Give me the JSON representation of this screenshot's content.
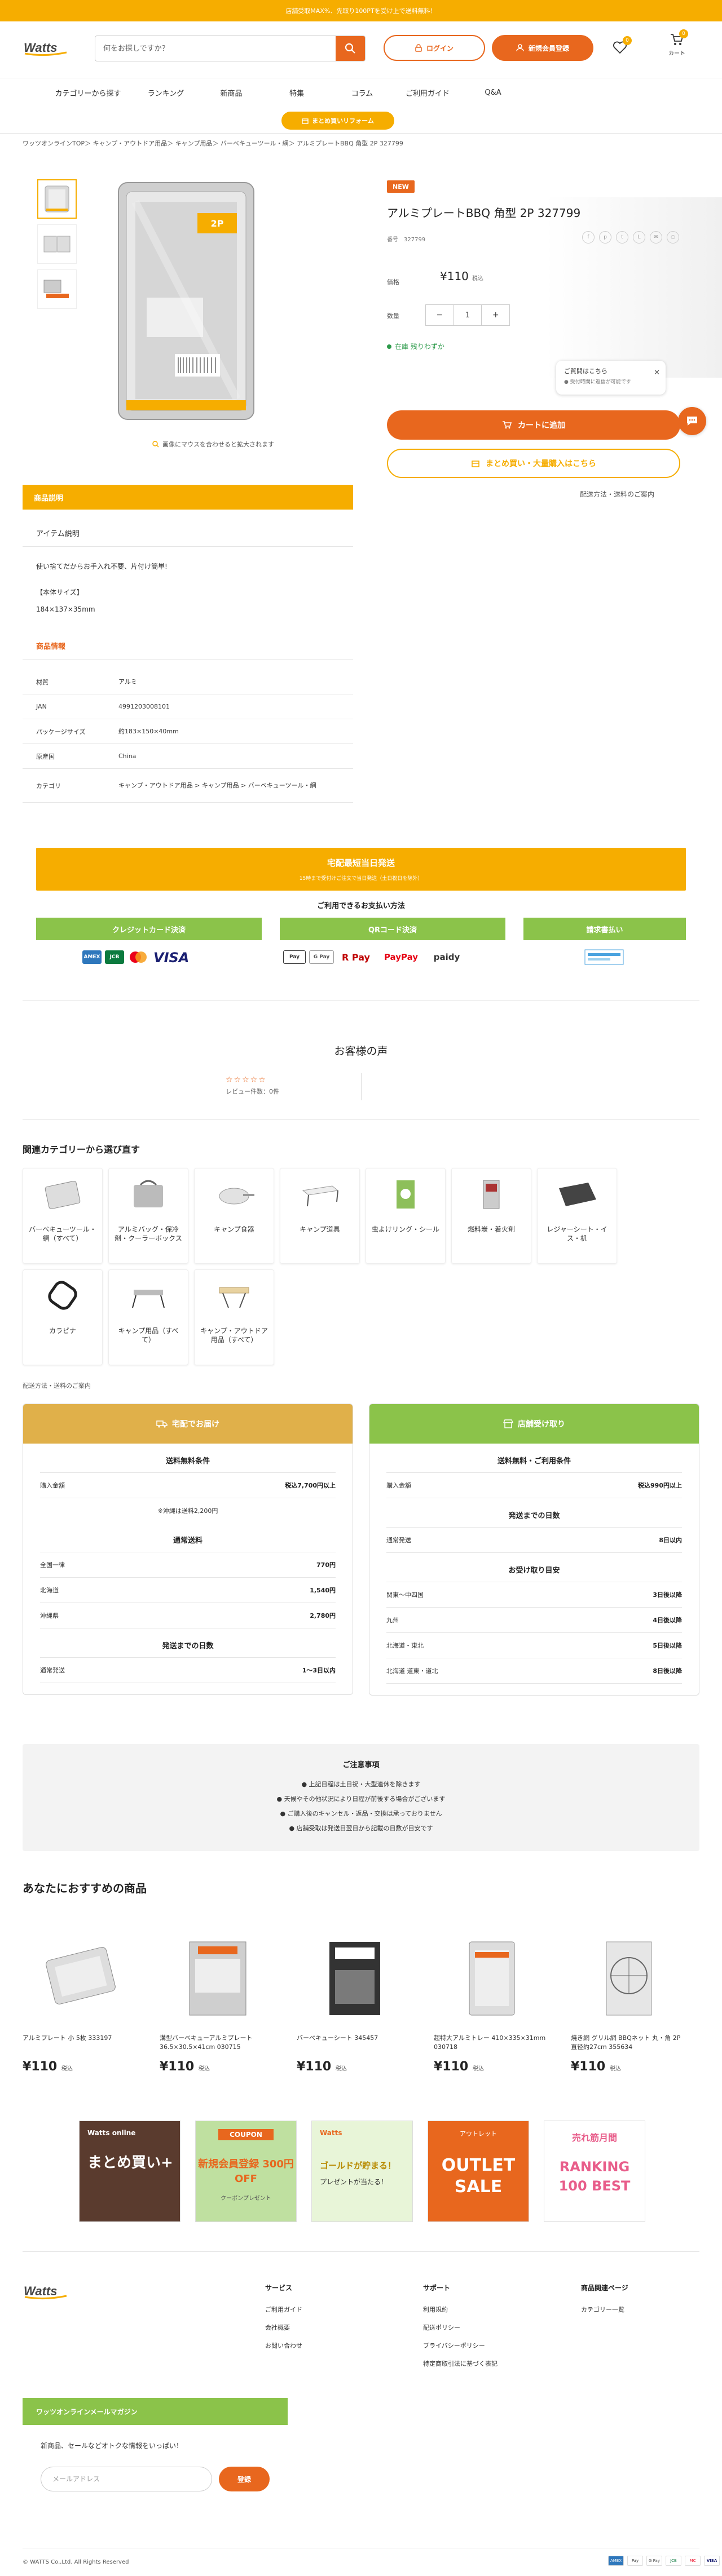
{
  "topbar": {
    "text": "店舗受取MAX%、先取り100PTを受け上で送料無料！"
  },
  "header": {
    "logo_text": "Watts",
    "search_placeholder": "何をお探しですか？",
    "login_label": "ログイン",
    "register_label": "新規会員登録",
    "fav_count": "0",
    "cart_count": "0",
    "cart_label": "カート"
  },
  "nav": {
    "items": [
      "カテゴリーから探す",
      "ランキング",
      "新商品",
      "特集",
      "コラム",
      "ご利用ガイド",
      "Q&A"
    ],
    "bulk_label": "まとめ買いリフォーム"
  },
  "breadcrumb": "ワッツオンラインTOP＞ キャンプ・アウトドア用品＞ キャンプ用品＞ バーベキューツール・網＞ アルミプレートBBQ 角型 2P 327799",
  "product": {
    "new_badge": "NEW",
    "title": "アルミプレートBBQ 角型 2P 327799",
    "number_label": "番号",
    "number_value": "327799",
    "price_label": "価格",
    "price": "¥110",
    "tax_label": "税込",
    "qty_label": "数量",
    "qty_minus": "−",
    "qty_value": "1",
    "qty_plus": "+",
    "stock": "在庫 残りわずか",
    "zoom_note": "画像にマウスを合わせると拡大されます",
    "add_cart": "カートに追加",
    "bulk_buy": "まとめ買い・大量購入はこちら",
    "ship_link": "配送方法・送料のご案内",
    "share_icons": [
      "f",
      "p",
      "t",
      "L",
      "✉",
      "○"
    ]
  },
  "chat": {
    "title": "ご質問はこちら",
    "sub": "● 受付時間に返信が可能です"
  },
  "description": {
    "head": "商品説明",
    "item_title": "アイテム説明",
    "text1": "使い捨てだからお手入れ不要、片付け簡単!",
    "size_label": "【本体サイズ】",
    "size_value": "184×137×35mm"
  },
  "specs": {
    "head": "商品情報",
    "rows": [
      {
        "k": "材質",
        "v": "アルミ"
      },
      {
        "k": "JAN",
        "v": "4991203008101"
      },
      {
        "k": "パッケージサイズ",
        "v": "約183×150×40mm"
      },
      {
        "k": "原産国",
        "v": "China"
      },
      {
        "k": "カテゴリ",
        "v": "キャンプ・アウトドア用品 > キャンプ用品 > バーベキューツール・網"
      }
    ]
  },
  "delivery_band": {
    "title": "宅配最短当日発送",
    "sub": "15時まで受付けご注文で当日発送（土日祝日を除外）"
  },
  "payment": {
    "head": "ご利用できるお支払い方法",
    "methods": [
      "クレジットカード決済",
      "QRコード決済",
      "請求書払い"
    ],
    "qr_logos": [
      "Pay",
      "G Pay",
      "R Pay",
      "PayPay",
      "paidy"
    ]
  },
  "reviews": {
    "title": "お客様の声",
    "stars": "☆☆☆☆☆",
    "count": "レビュー件数：0件"
  },
  "categories": {
    "title": "関連カテゴリーから選び直す",
    "items": [
      "バーベキューツール・網（すべて）",
      "アルミバッグ・保冷剤・クーラーボックス",
      "キャンプ食器",
      "キャンプ道具",
      "虫よけリング・シール",
      "燃料炭・着火剤",
      "レジャーシート・イス・机",
      "カラビナ",
      "キャンプ用品（すべて）",
      "キャンプ・アウトドア用品（すべて）"
    ]
  },
  "shipping": {
    "note": "配送方法・送料のご案内",
    "home": {
      "head": "宅配でお届け",
      "free_title": "送料無料条件",
      "free_k": "購入金額",
      "free_v": "税込7,700円以上",
      "free_note": "※沖縄は送料2,200円",
      "fee_title": "通常送料",
      "fees": [
        {
          "k": "全国一律",
          "v": "770円"
        },
        {
          "k": "北海道",
          "v": "1,540円"
        },
        {
          "k": "沖縄県",
          "v": "2,780円"
        }
      ],
      "days_title": "発送までの日数",
      "days_k": "通常発送",
      "days_v": "1〜3日以内"
    },
    "store": {
      "head": "店舗受け取り",
      "free_title": "送料無料・ご利用条件",
      "free_k": "購入金額",
      "free_v": "税込990円以上",
      "days_title": "発送までの日数",
      "days_k": "通常発送",
      "days_v": "8日以内",
      "recv_title": "お受け取り目安",
      "recv": [
        {
          "k": "関東〜中四国",
          "v": "3日後以降"
        },
        {
          "k": "九州",
          "v": "4日後以降"
        },
        {
          "k": "北海道・東北",
          "v": "5日後以降"
        },
        {
          "k": "北海道 道東・道北",
          "v": "8日後以降"
        }
      ]
    }
  },
  "notice": {
    "title": "ご注意事項",
    "lines": [
      "上記日程は土日祝・大型連休を除きます",
      "天候やその他状況により日程が前後する場合がございます",
      "ご購入後のキャンセル・返品・交換は承っておりません",
      "店舗受取は発送日翌日から記載の日数が目安です"
    ]
  },
  "recommend": {
    "title": "あなたにおすすめの商品",
    "items": [
      {
        "name": "アルミプレート 小 5枚 333197",
        "price": "¥110",
        "tax": "税込"
      },
      {
        "name": "溝型バーベキューアルミプレート 36.5×30.5×41cm 030715",
        "price": "¥110",
        "tax": "税込"
      },
      {
        "name": "バーベキューシート 345457",
        "price": "¥110",
        "tax": "税込"
      },
      {
        "name": "超特大アルミトレー 410×335×31mm 030718",
        "price": "¥110",
        "tax": "税込"
      },
      {
        "name": "焼き網 グリル網 BBQネット 丸・角 2P 直径約27cm 355634",
        "price": "¥110",
        "tax": "税込"
      }
    ]
  },
  "banners": [
    {
      "top": "Watts online",
      "main": "まとめ買い+"
    },
    {
      "top": "COUPON",
      "main": "新規会員登録 300円OFF",
      "sub": "クーポンプレゼント"
    },
    {
      "top": "Watts",
      "main": "ゴールドが貯まる！",
      "sub": "プレゼントが当たる！"
    },
    {
      "top": "アウトレット",
      "main": "OUTLET SALE"
    },
    {
      "top": "売れ筋月間",
      "main": "RANKING 100 BEST"
    }
  ],
  "footer": {
    "logo_text": "Watts",
    "services_head": "サービス",
    "services": [
      "ご利用ガイド",
      "会社概要",
      "お問い合わせ"
    ],
    "support_head": "サポート",
    "support": [
      "利用規約",
      "配送ポリシー",
      "プライバシーポリシー",
      "特定商取引法に基づく表記"
    ],
    "related_head": "商品関連ページ",
    "related": [
      "カテゴリー一覧"
    ],
    "mm_head": "ワッツオンラインメールマガジン",
    "mm_text": "新商品、セールなどオトクな情報をいっぱい！",
    "mm_placeholder": "メールアドレス",
    "mm_button": "登録",
    "copyright": "© WATTS Co.,Ltd. All Rights Reserved",
    "pay_icons": [
      "AMEX",
      "Pay",
      "G Pay",
      "JCB",
      "MC",
      "VISA"
    ]
  }
}
